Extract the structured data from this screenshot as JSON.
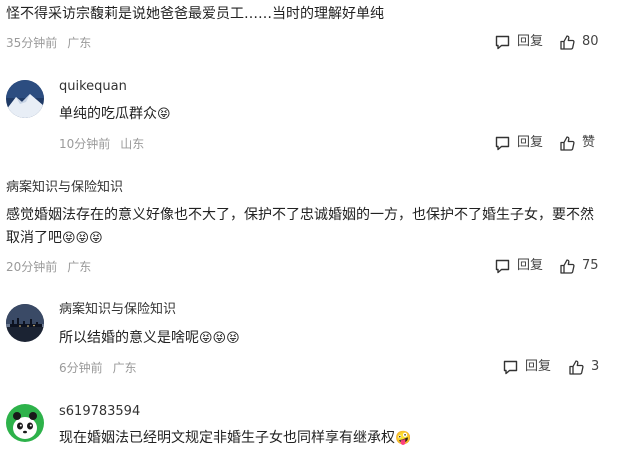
{
  "comments": [
    {
      "text": "怪不得采访宗馥莉是说她爸爸最爱员工……当时的理解好单纯",
      "time": "35分钟前",
      "location": "广东",
      "reply_label": "回复",
      "like_count": "80"
    },
    {
      "username": "quikequan",
      "text": "单纯的吃瓜群众",
      "emojis": "😝",
      "time": "10分钟前",
      "location": "山东",
      "reply_label": "回复",
      "like_label": "赞"
    },
    {
      "username": "病案知识与保险知识",
      "text_line1": "感觉婚姻法存在的意义好像也不大了，保护不了忠诚婚姻的一方，也保护不了婚生子女，要不然",
      "text_line2": "取消了吧",
      "emojis": "😝😝😝",
      "time": "20分钟前",
      "location": "广东",
      "reply_label": "回复",
      "like_count": "75"
    },
    {
      "username": "病案知识与保险知识",
      "text": "所以结婚的意义是啥呢",
      "emojis": "😝😝😝",
      "time": "6分钟前",
      "location": "广东",
      "reply_label": "回复",
      "like_count": "3"
    },
    {
      "username": "s619783594",
      "text": "现在婚姻法已经明文规定非婚生子女也同样享有继承权",
      "emojis": "🤪"
    }
  ],
  "colors": {
    "text": "#222222",
    "meta": "#9a9a9a",
    "avatar_green": "#2db24a"
  },
  "icons": [
    "comment-icon",
    "thumbs-up-icon"
  ]
}
